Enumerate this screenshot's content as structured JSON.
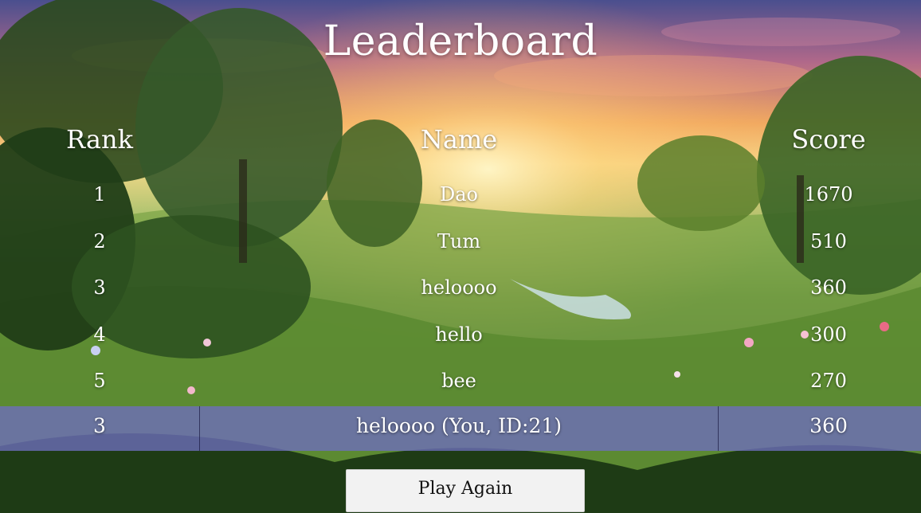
{
  "title": "Leaderboard",
  "headers": {
    "rank": "Rank",
    "name": "Name",
    "score": "Score"
  },
  "rows": [
    {
      "rank": "1",
      "name": "Dao",
      "score": "1670"
    },
    {
      "rank": "2",
      "name": "Tum",
      "score": "510"
    },
    {
      "rank": "3",
      "name": "heloooo",
      "score": "360"
    },
    {
      "rank": "4",
      "name": "hello",
      "score": "300"
    },
    {
      "rank": "5",
      "name": "bee",
      "score": "270"
    }
  ],
  "current_player": {
    "rank": "3",
    "name": "heloooo (You, ID:21)",
    "score": "360"
  },
  "play_again_label": "Play Again",
  "colors": {
    "highlight_row": "#6e6ebe",
    "button_bg": "#f2f2f2",
    "text": "#ffffff"
  }
}
